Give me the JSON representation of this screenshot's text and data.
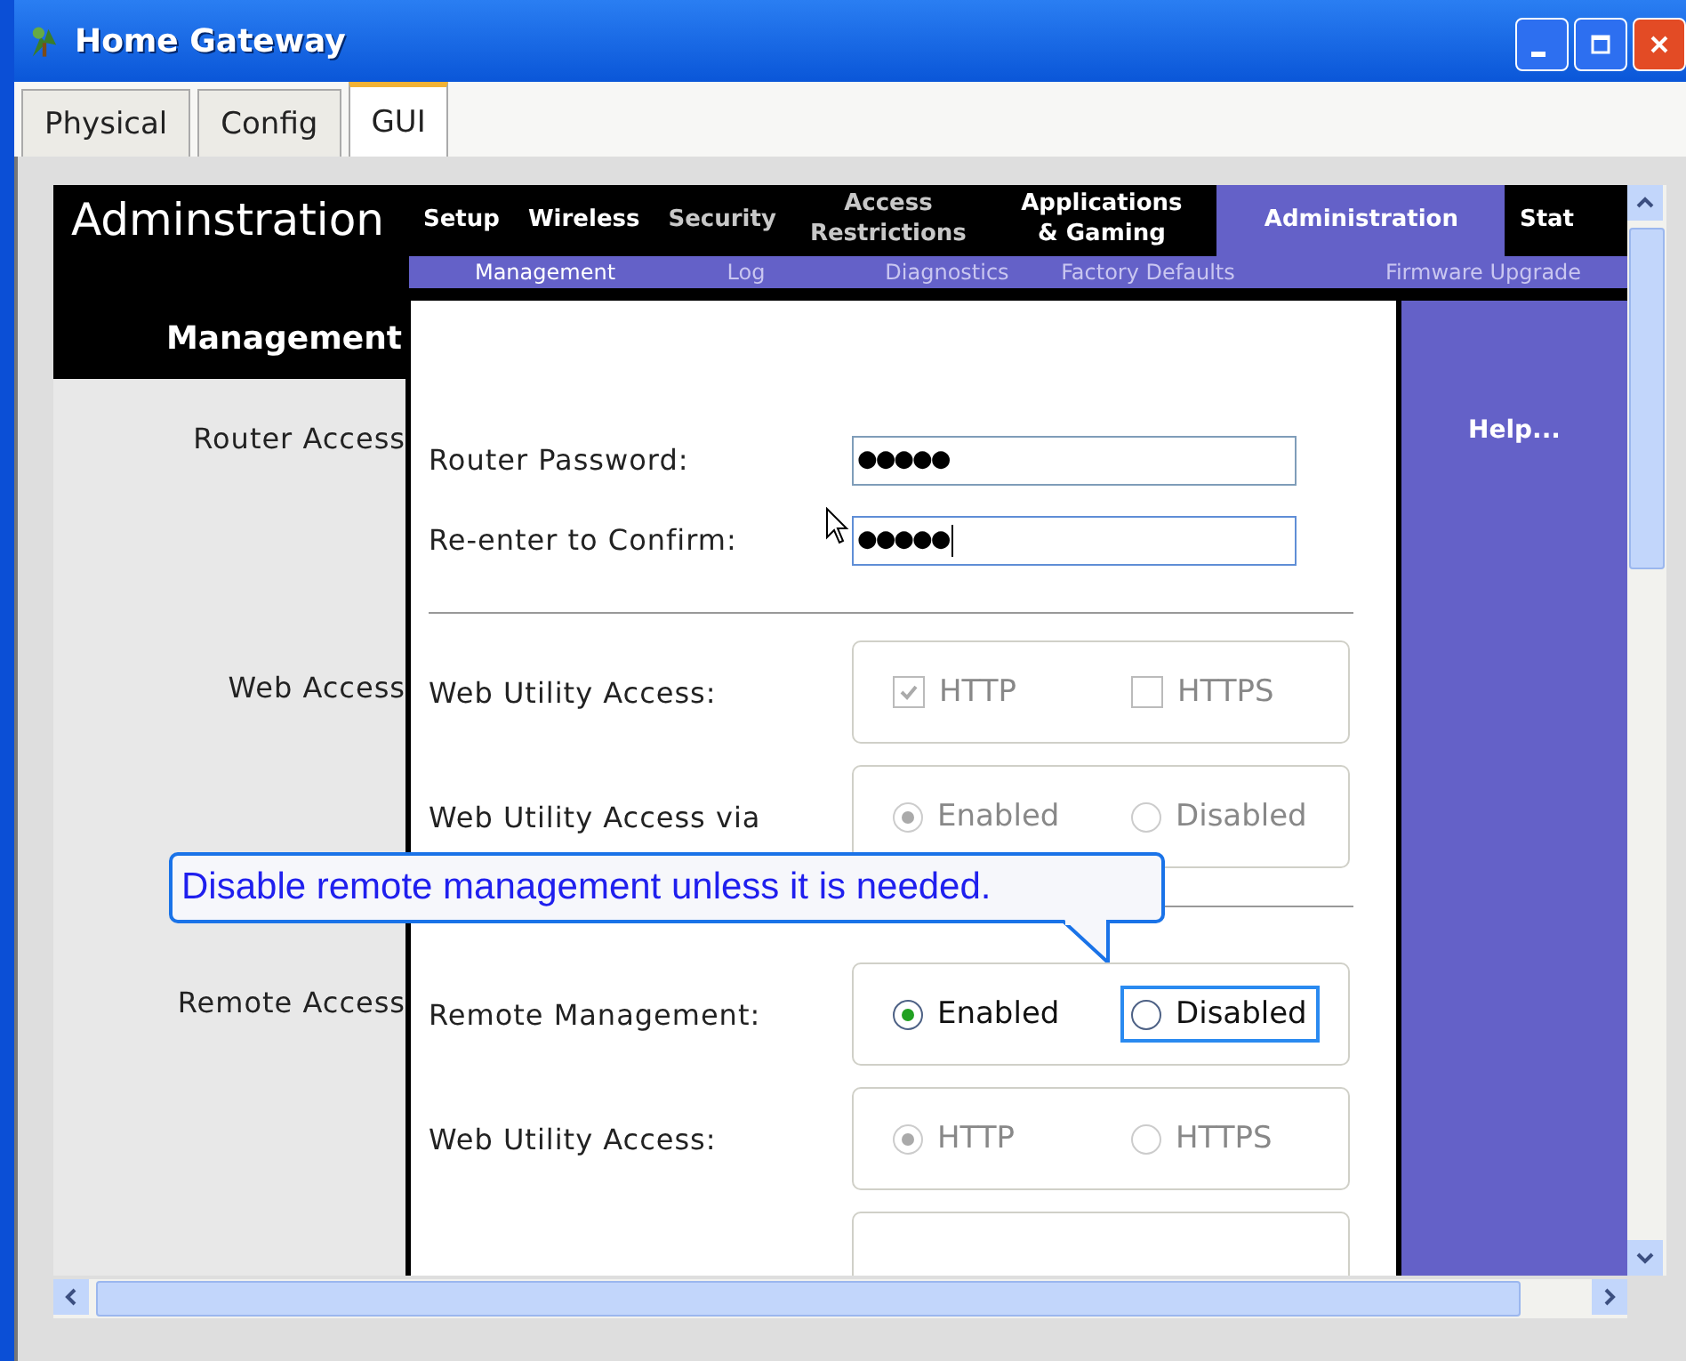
{
  "window": {
    "title": "Home Gateway"
  },
  "tabs": [
    {
      "label": "Physical",
      "selected": false
    },
    {
      "label": "Config",
      "selected": false
    },
    {
      "label": "GUI",
      "selected": true
    }
  ],
  "header": {
    "title": "Adminstration",
    "nav": [
      {
        "label": "Setup",
        "selected": false,
        "dimmed": false
      },
      {
        "label": "Wireless",
        "selected": false,
        "dimmed": false
      },
      {
        "label": "Security",
        "selected": false,
        "dimmed": true
      },
      {
        "label": "Access Restrictions",
        "selected": false,
        "dimmed": true
      },
      {
        "label": "Applications & Gaming",
        "selected": false,
        "dimmed": false
      },
      {
        "label": "Administration",
        "selected": true,
        "dimmed": false
      },
      {
        "label": "Stat",
        "selected": false,
        "dimmed": false
      }
    ],
    "subnav": [
      {
        "label": "Management",
        "selected": true
      },
      {
        "label": "Log",
        "selected": false
      },
      {
        "label": "Diagnostics",
        "selected": false
      },
      {
        "label": "Factory Defaults",
        "selected": false
      },
      {
        "label": "Firmware Upgrade",
        "selected": false
      }
    ]
  },
  "sidebar": {
    "heading": "Management"
  },
  "sections": [
    {
      "label": "Router Access",
      "rows": [
        {
          "kind": "field",
          "label": "Router Password:",
          "value": "●●●●●",
          "focused": false
        },
        {
          "kind": "field",
          "label": "Re-enter to Confirm:",
          "value": "●●●●●",
          "focused": true
        }
      ]
    },
    {
      "label": "Web Access",
      "rows": [
        {
          "kind": "checkbox",
          "label": "Web Utility Access:",
          "disabled": true,
          "options": [
            {
              "label": "HTTP",
              "checked": true,
              "focused": false
            },
            {
              "label": "HTTPS",
              "checked": false,
              "focused": false
            }
          ]
        },
        {
          "kind": "radio",
          "label": "Web Utility Access via",
          "disabled": true,
          "options": [
            {
              "label": "Enabled",
              "selected": true,
              "focused": false
            },
            {
              "label": "Disabled",
              "selected": false,
              "focused": false
            }
          ]
        }
      ]
    },
    {
      "label": "Remote Access",
      "rows": [
        {
          "kind": "radio",
          "label": "Remote Management:",
          "disabled": false,
          "options": [
            {
              "label": "Enabled",
              "selected": true,
              "focused": false
            },
            {
              "label": "Disabled",
              "selected": false,
              "focused": true
            }
          ]
        },
        {
          "kind": "radio",
          "label": "Web Utility Access:",
          "disabled": true,
          "options": [
            {
              "label": "HTTP",
              "selected": true,
              "focused": false
            },
            {
              "label": "HTTPS",
              "selected": false,
              "focused": false
            }
          ]
        }
      ]
    }
  ],
  "help": {
    "label": "Help..."
  },
  "tooltip": {
    "text": "Disable remote management unless it is needed."
  }
}
